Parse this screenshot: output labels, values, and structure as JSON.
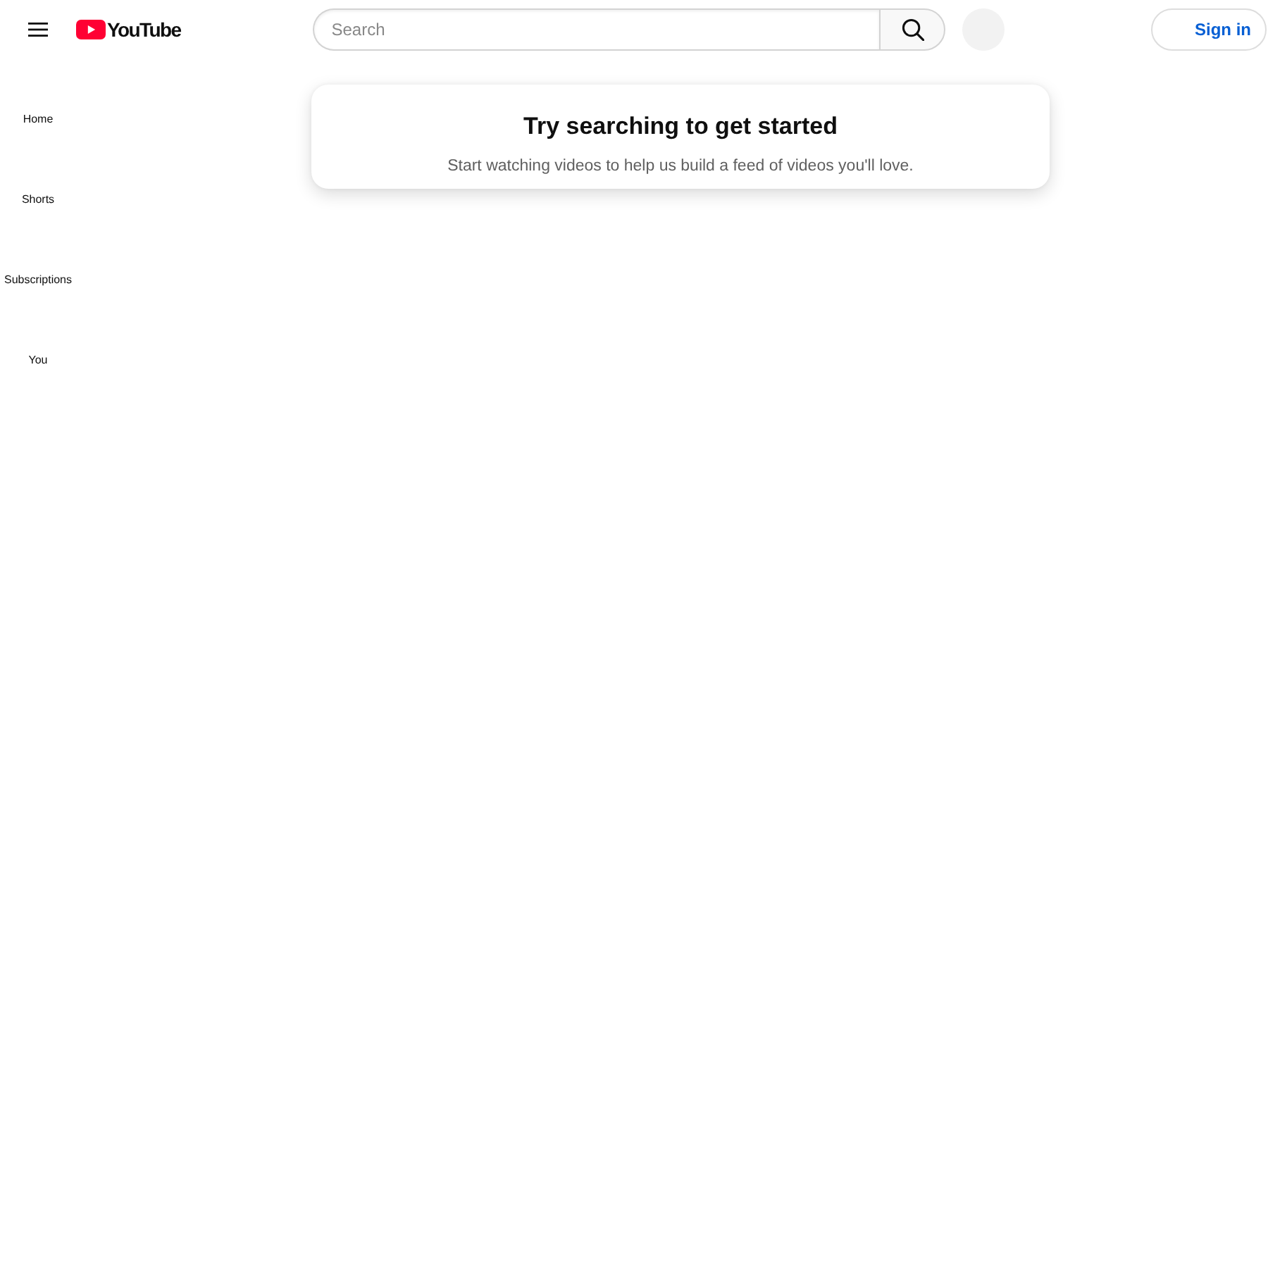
{
  "header": {
    "logo": {
      "text": "YouTube"
    },
    "search": {
      "placeholder": "Search"
    },
    "sign_in": {
      "label": "Sign in"
    }
  },
  "sidebar": {
    "items": [
      {
        "label": "Home"
      },
      {
        "label": "Shorts"
      },
      {
        "label": "Subscriptions"
      },
      {
        "label": "You"
      }
    ]
  },
  "prompt": {
    "title": "Try searching to get started",
    "message": "Start watching videos to help us build a feed of videos you'll love."
  }
}
